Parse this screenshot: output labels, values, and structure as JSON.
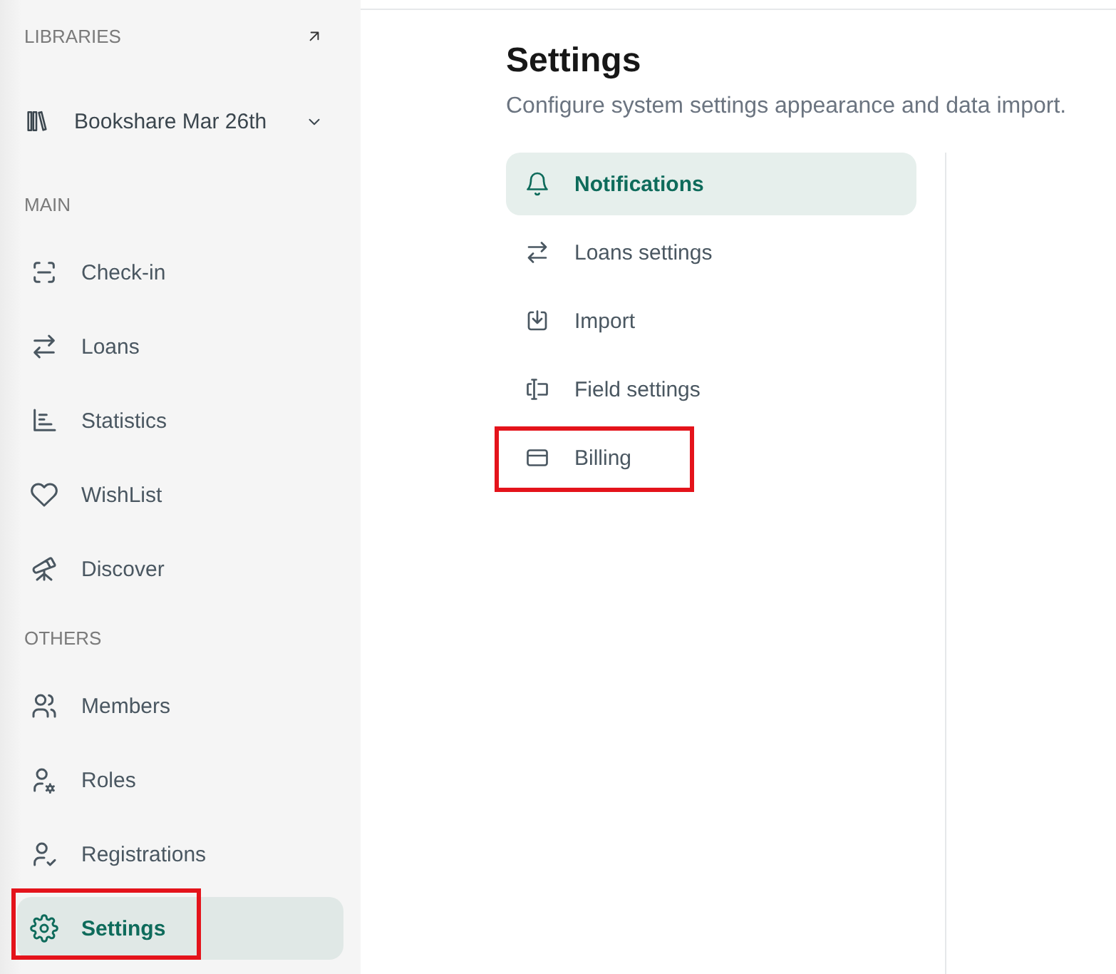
{
  "sidebar": {
    "libraries_heading": "LIBRARIES",
    "library": {
      "name": "Bookshare Mar 26th"
    },
    "sections": [
      {
        "heading": "MAIN",
        "items": [
          {
            "label": "Check-in",
            "selected": false,
            "highlighted": false
          },
          {
            "label": "Loans",
            "selected": false,
            "highlighted": false
          },
          {
            "label": "Statistics",
            "selected": false,
            "highlighted": false
          },
          {
            "label": "WishList",
            "selected": false,
            "highlighted": false
          },
          {
            "label": "Discover",
            "selected": false,
            "highlighted": false
          }
        ]
      },
      {
        "heading": "OTHERS",
        "items": [
          {
            "label": "Members",
            "selected": false,
            "highlighted": false
          },
          {
            "label": "Roles",
            "selected": false,
            "highlighted": false
          },
          {
            "label": "Registrations",
            "selected": false,
            "highlighted": false
          },
          {
            "label": "Settings",
            "selected": true,
            "highlighted": true
          }
        ]
      }
    ]
  },
  "settings": {
    "title": "Settings",
    "subtitle": "Configure system settings appearance and data import.",
    "menu": [
      {
        "label": "Notifications",
        "selected": true,
        "highlighted": false
      },
      {
        "label": "Loans settings",
        "selected": false,
        "highlighted": false
      },
      {
        "label": "Import",
        "selected": false,
        "highlighted": false
      },
      {
        "label": "Field settings",
        "selected": false,
        "highlighted": false
      },
      {
        "label": "Billing",
        "selected": false,
        "highlighted": true
      }
    ]
  }
}
